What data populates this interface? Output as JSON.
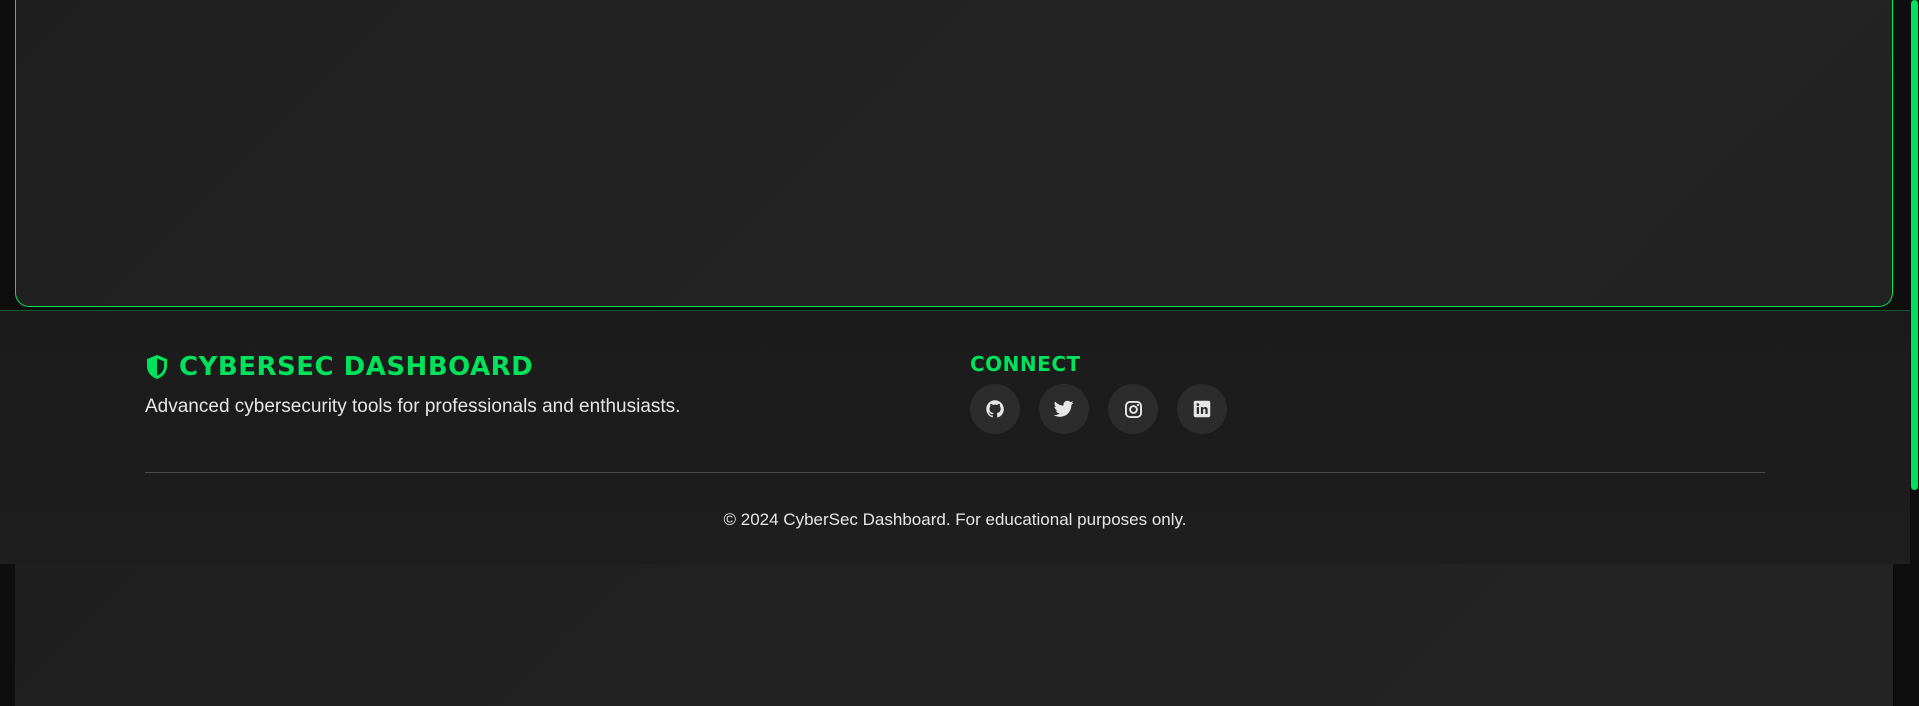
{
  "brand": {
    "title": "CYBERSEC DASHBOARD",
    "description": "Advanced cybersecurity tools for professionals and enthusiasts."
  },
  "connect": {
    "title": "CONNECT",
    "links": [
      {
        "icon": "github-icon"
      },
      {
        "icon": "twitter-icon"
      },
      {
        "icon": "instagram-icon"
      },
      {
        "icon": "linkedin-icon"
      }
    ]
  },
  "copyright": "© 2024 CyberSec Dashboard. For educational purposes only.",
  "colors": {
    "accent": "#00e25b",
    "background": "#1e1e1e",
    "text": "#e6e6e6"
  }
}
